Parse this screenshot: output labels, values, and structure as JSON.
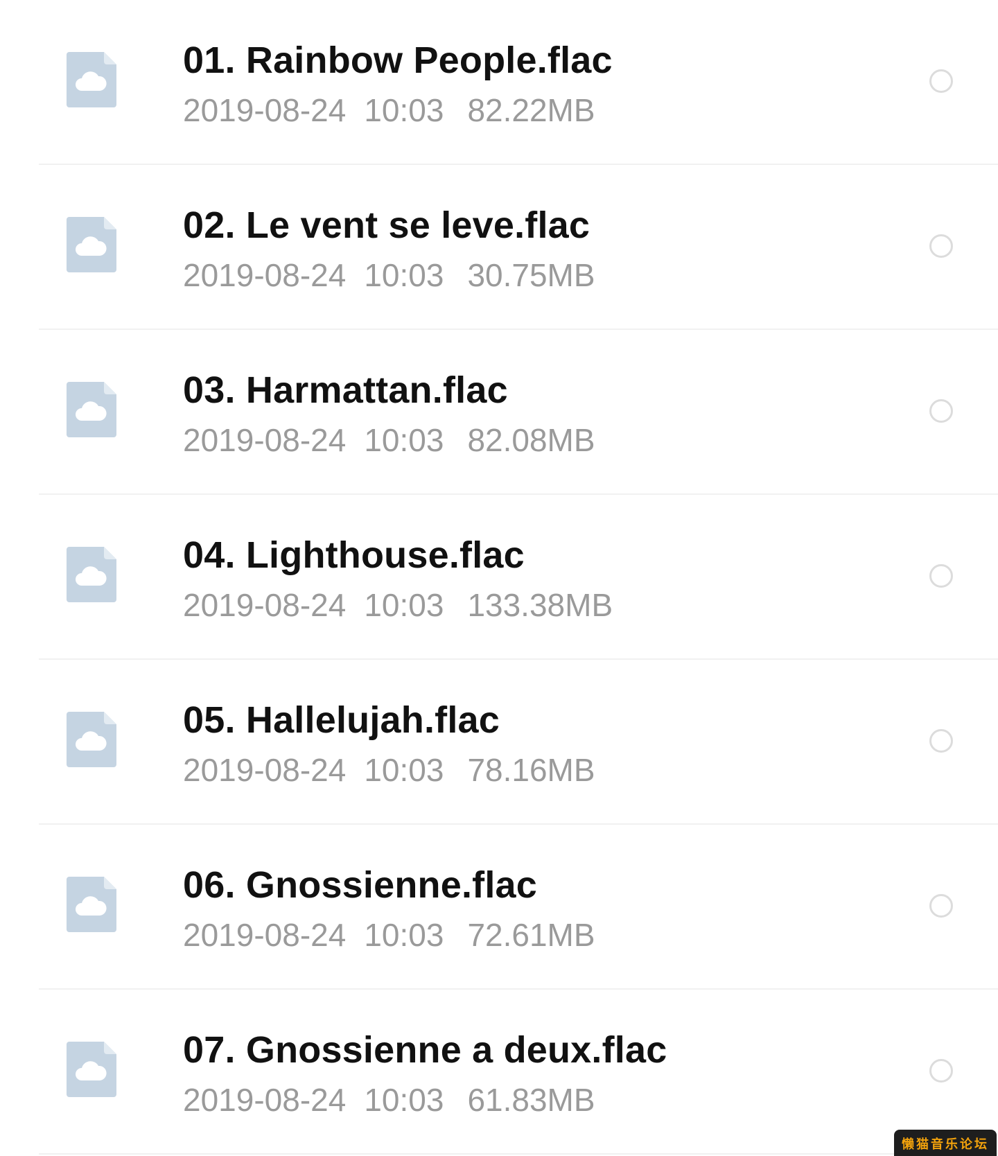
{
  "colors": {
    "title_text": "#111111",
    "meta_text": "#9a9a9a",
    "icon_fill": "#c5d4e2",
    "divider": "#f1f1f1",
    "radio_border": "#dcdcdc"
  },
  "icons": {
    "file": "cloud-file-icon",
    "select": "radio-unchecked-icon"
  },
  "files": [
    {
      "name": "01. Rainbow People.flac",
      "date": "2019-08-24",
      "time": "10:03",
      "size": "82.22MB"
    },
    {
      "name": "02. Le vent se leve.flac",
      "date": "2019-08-24",
      "time": "10:03",
      "size": "30.75MB"
    },
    {
      "name": "03. Harmattan.flac",
      "date": "2019-08-24",
      "time": "10:03",
      "size": "82.08MB"
    },
    {
      "name": "04. Lighthouse.flac",
      "date": "2019-08-24",
      "time": "10:03",
      "size": "133.38MB"
    },
    {
      "name": "05. Hallelujah.flac",
      "date": "2019-08-24",
      "time": "10:03",
      "size": "78.16MB"
    },
    {
      "name": "06. Gnossienne.flac",
      "date": "2019-08-24",
      "time": "10:03",
      "size": "72.61MB"
    },
    {
      "name": "07. Gnossienne a deux.flac",
      "date": "2019-08-24",
      "time": "10:03",
      "size": "61.83MB"
    }
  ],
  "watermark": {
    "text": "懒猫音乐论坛"
  }
}
